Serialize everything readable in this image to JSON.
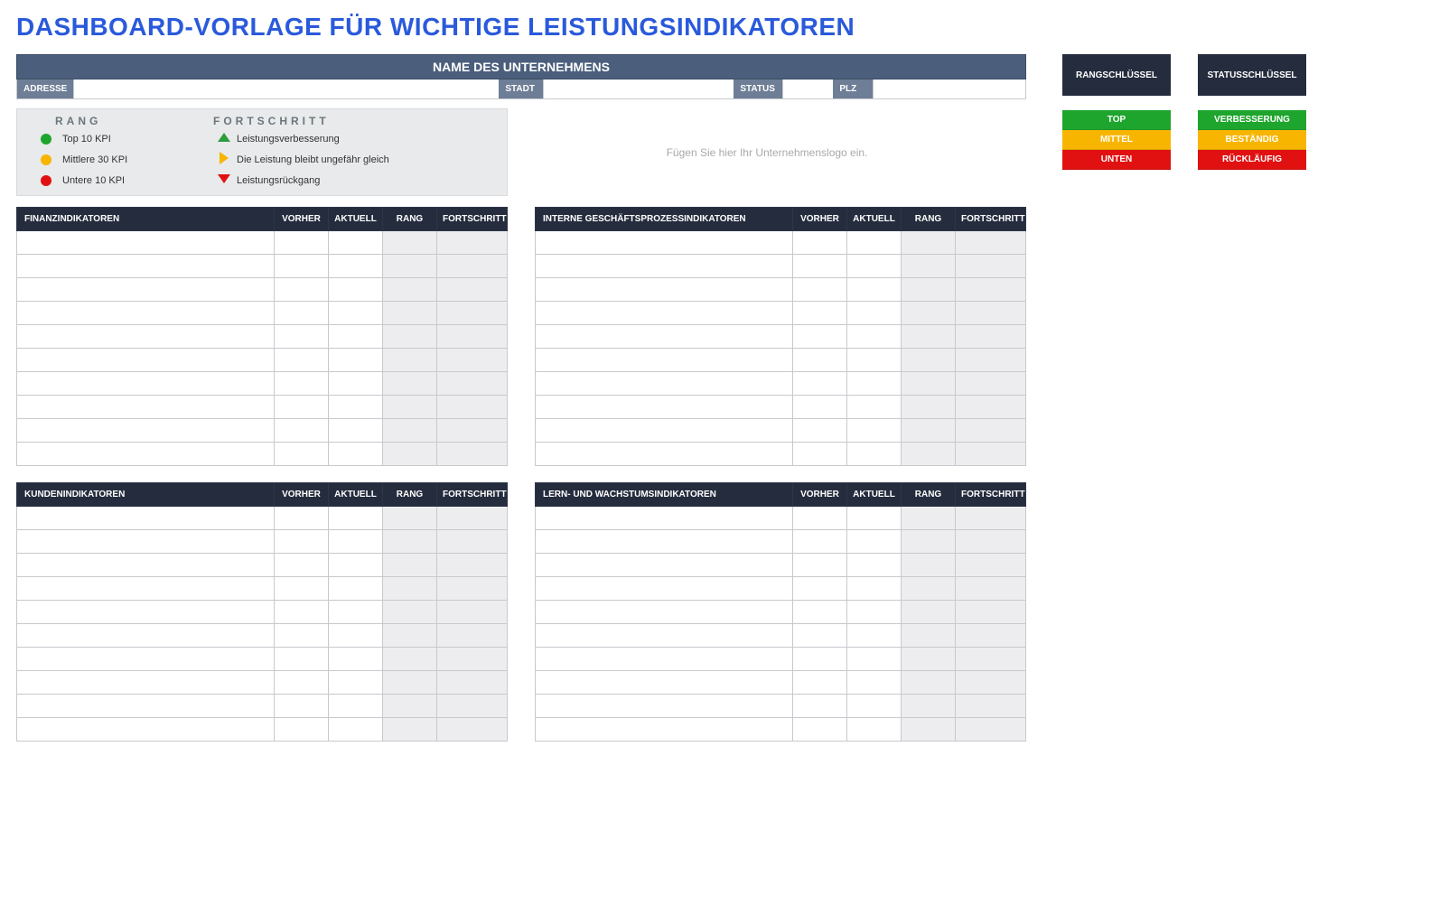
{
  "title": "DASHBOARD-VORLAGE FÜR WICHTIGE LEISTUNGSINDIKATOREN",
  "company": {
    "name_label": "NAME DES UNTERNEHMENS",
    "adresse_label": "ADRESSE",
    "stadt_label": "STADT",
    "status_label": "STATUS",
    "plz_label": "PLZ",
    "adresse": "",
    "stadt": "",
    "status": "",
    "plz": ""
  },
  "legend": {
    "rank_header": "RANG",
    "progress_header": "FORTSCHRITT",
    "ranks": [
      {
        "color": "#1ea52d",
        "label": "Top 10 KPI"
      },
      {
        "color": "#f7b500",
        "label": "Mittlere 30 KPI"
      },
      {
        "color": "#e11111",
        "label": "Untere 10 KPI"
      }
    ],
    "progress": [
      {
        "icon": "up",
        "label": "Leistungsverbesserung"
      },
      {
        "icon": "right",
        "label": "Die Leistung bleibt ungefähr gleich"
      },
      {
        "icon": "down",
        "label": "Leistungsrückgang"
      }
    ]
  },
  "logo_placeholder": "Fügen Sie hier Ihr Unternehmenslogo ein.",
  "columns": {
    "vorher": "VORHER",
    "aktuell": "AKTUELL",
    "rang": "RANG",
    "fortschritt": "FORTSCHRITT"
  },
  "tables": {
    "t1_title": "FINANZINDIKATOREN",
    "t2_title": "INTERNE GESCHÄFTSPROZESSINDIKATOREN",
    "t3_title": "KUNDENINDIKATOREN",
    "t4_title": "LERN- UND WACHSTUMSINDIKATOREN"
  },
  "side": {
    "rank_key": "RANGSCHLÜSSEL",
    "status_key": "STATUSSCHLÜSSEL",
    "rank_items": [
      {
        "class": "c-green",
        "label": "TOP"
      },
      {
        "class": "c-amber",
        "label": "MITTEL"
      },
      {
        "class": "c-red",
        "label": "UNTEN"
      }
    ],
    "status_items": [
      {
        "class": "c-green",
        "label": "VERBESSERUNG"
      },
      {
        "class": "c-amber",
        "label": "BESTÄNDIG"
      },
      {
        "class": "c-red",
        "label": "RÜCKLÄUFIG"
      }
    ]
  }
}
